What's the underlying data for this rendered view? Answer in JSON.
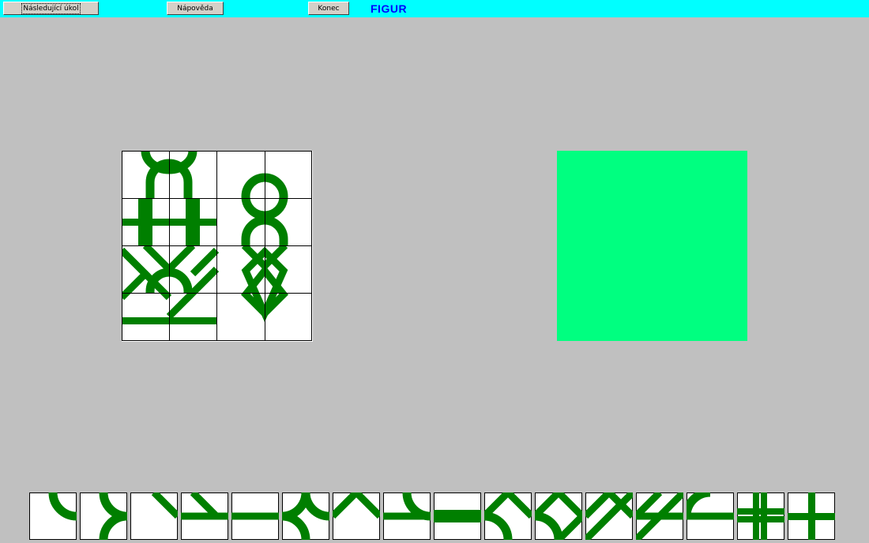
{
  "toolbar": {
    "next_task_label": "Následující úkol",
    "help_label": "Nápověda",
    "exit_label": "Konec",
    "title": "FIGUR",
    "background": "#00ffff",
    "title_color": "#0000ff"
  },
  "colors": {
    "workspace": "#c0c0c0",
    "tile_fill": "#ffffff",
    "stroke_green": "#007f00",
    "target_fill": "#00ff80"
  },
  "palette": {
    "tiles": [
      "quarter-arc-top-right",
      "double-half-arc-right",
      "diagonal-top-right",
      "t-junction-diagonal-bar",
      "horizontal-bar",
      "double-half-arc-left-right",
      "v-shape-top",
      "bar-with-top-arc",
      "thick-horizontal-bar",
      "diagonal-with-bottom-arc",
      "diamond-with-arc",
      "x-diagonal-top",
      "diagonal-bar",
      "arc-bar",
      "thick-cross",
      "cross"
    ]
  }
}
